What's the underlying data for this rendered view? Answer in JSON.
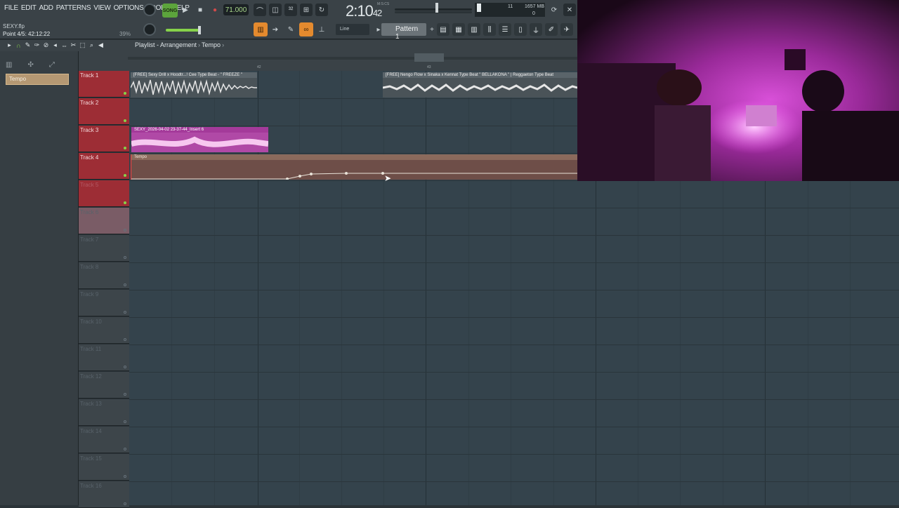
{
  "menu": [
    "FILE",
    "EDIT",
    "ADD",
    "PATTERNS",
    "VIEW",
    "OPTIONS",
    "TOOLS",
    "HELP"
  ],
  "project": {
    "file_name": "SEXY.flp",
    "hint": "Point 4/5: 42:12:22",
    "hint_percent": "39%"
  },
  "transport": {
    "mode": "SONG",
    "tempo": "71.000",
    "time_main": "2:10",
    "time_sub": "42",
    "time_label": "M:S:CS"
  },
  "status": {
    "cpu": "11",
    "memory": "1657 MB",
    "cpu2": "0"
  },
  "toolbar2": {
    "snap_mode": "Line",
    "pattern": "Pattern 1"
  },
  "playlist": {
    "title": "Playlist - Arrangement",
    "breadcrumb": "Tempo"
  },
  "browser": {
    "item": "Tempo"
  },
  "ruler": {
    "bar_42": "42",
    "bar_43": "43"
  },
  "tracks": [
    {
      "name": "Track 1"
    },
    {
      "name": "Track 2"
    },
    {
      "name": "Track 3"
    },
    {
      "name": "Track 4"
    },
    {
      "name": "Track 5"
    },
    {
      "name": "Track 6"
    },
    {
      "name": "Track 7"
    },
    {
      "name": "Track 8"
    },
    {
      "name": "Track 9"
    },
    {
      "name": "Track 10"
    },
    {
      "name": "Track 11"
    },
    {
      "name": "Track 12"
    },
    {
      "name": "Track 13"
    },
    {
      "name": "Track 14"
    },
    {
      "name": "Track 15"
    },
    {
      "name": "Track 16"
    }
  ],
  "clips": {
    "clip1": "[FREE] Sexy Drill x Hoodtr...! Cee Type Beat - \" FREEZE \"",
    "clip2": "[FREE] Ñengo Flow x Sinaka x Kennat Type Beat \" BELLAKONA \" | Reggaeton Type Beat",
    "clip3": "SEXY_2026-04-02 23-37-44_Insert 6",
    "clip4": "Tempo"
  },
  "colors": {
    "accent_orange": "#e48a2e",
    "track_red": "#9d2d35",
    "song_green": "#5ca43c",
    "clip_pink": "#b049a6"
  }
}
